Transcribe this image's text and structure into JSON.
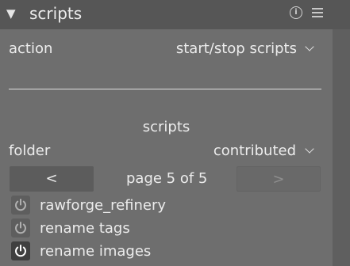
{
  "header": {
    "title": "scripts",
    "collapse_icon": "triangle-down-icon",
    "info_icon": "info-circle-icon",
    "menu_icon": "hamburger-menu-icon",
    "info_glyph": "i"
  },
  "action": {
    "label": "action",
    "value": "start/stop scripts"
  },
  "text_entry": {
    "value": ""
  },
  "section": {
    "title": "scripts"
  },
  "folder": {
    "label": "folder",
    "value": "contributed"
  },
  "pager": {
    "prev_label": "<",
    "page_text": "page 5 of 5",
    "next_label": ">"
  },
  "scripts": [
    {
      "name": "rawforge_refinery",
      "enabled": false
    },
    {
      "name": "rename tags",
      "enabled": false
    },
    {
      "name": "rename images",
      "enabled": true
    }
  ],
  "colors": {
    "panel_bg": "#6e6e6e",
    "header_bg": "#565656",
    "text": "#ececec",
    "power_on": "#ffffff",
    "power_off": "#b0b0b0"
  }
}
